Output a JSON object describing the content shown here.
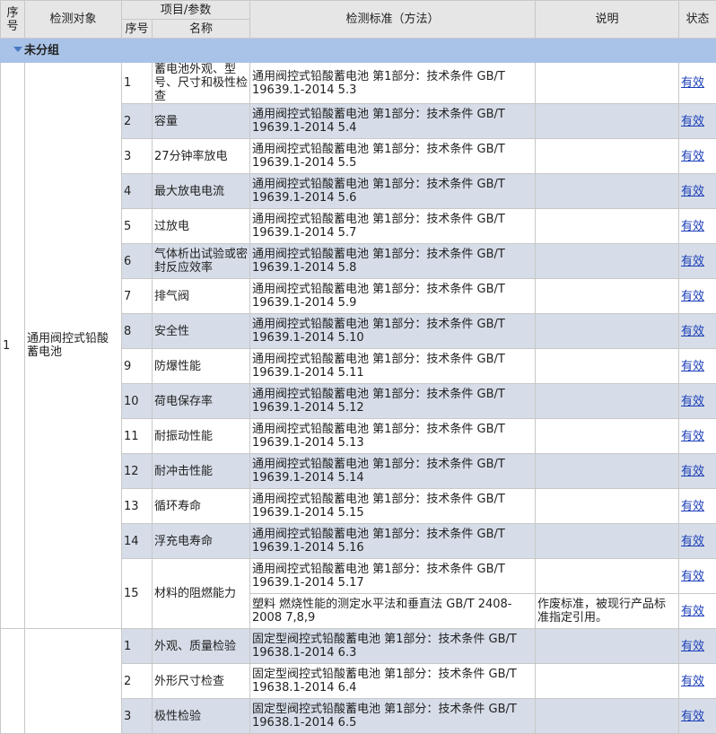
{
  "header": {
    "col_seq": "序号",
    "col_object": "检测对象",
    "col_project": "项目/参数",
    "col_sub_seq": "序号",
    "col_name": "名称",
    "col_standard": "检测标准（方法）",
    "col_note": "说明",
    "col_status": "状态"
  },
  "group": {
    "label": "未分组"
  },
  "objects": [
    {
      "seq": "1",
      "name": "通用阀控式铅酸蓄电池",
      "rows": [
        {
          "no": "1",
          "name": "蓄电池外观、型号、尺寸和极性检查",
          "standard": "通用阀控式铅酸蓄电池 第1部分：技术条件 GB/T 19639.1-2014 5.3",
          "note": "",
          "status": "有效"
        },
        {
          "no": "2",
          "name": "容量",
          "standard": "通用阀控式铅酸蓄电池 第1部分：技术条件 GB/T 19639.1-2014 5.4",
          "note": "",
          "status": "有效"
        },
        {
          "no": "3",
          "name": "27分钟率放电",
          "standard": "通用阀控式铅酸蓄电池 第1部分：技术条件 GB/T 19639.1-2014 5.5",
          "note": "",
          "status": "有效"
        },
        {
          "no": "4",
          "name": "最大放电电流",
          "standard": "通用阀控式铅酸蓄电池 第1部分：技术条件 GB/T 19639.1-2014 5.6",
          "note": "",
          "status": "有效"
        },
        {
          "no": "5",
          "name": "过放电",
          "standard": "通用阀控式铅酸蓄电池 第1部分：技术条件 GB/T 19639.1-2014 5.7",
          "note": "",
          "status": "有效"
        },
        {
          "no": "6",
          "name": "气体析出试验或密封反应效率",
          "standard": "通用阀控式铅酸蓄电池 第1部分：技术条件 GB/T 19639.1-2014 5.8",
          "note": "",
          "status": "有效"
        },
        {
          "no": "7",
          "name": "排气阀",
          "standard": "通用阀控式铅酸蓄电池 第1部分：技术条件 GB/T 19639.1-2014 5.9",
          "note": "",
          "status": "有效"
        },
        {
          "no": "8",
          "name": "安全性",
          "standard": "通用阀控式铅酸蓄电池 第1部分：技术条件 GB/T 19639.1-2014 5.10",
          "note": "",
          "status": "有效"
        },
        {
          "no": "9",
          "name": "防爆性能",
          "standard": "通用阀控式铅酸蓄电池 第1部分：技术条件 GB/T 19639.1-2014 5.11",
          "note": "",
          "status": "有效"
        },
        {
          "no": "10",
          "name": "荷电保存率",
          "standard": "通用阀控式铅酸蓄电池 第1部分：技术条件 GB/T 19639.1-2014 5.12",
          "note": "",
          "status": "有效"
        },
        {
          "no": "11",
          "name": "耐振动性能",
          "standard": "通用阀控式铅酸蓄电池 第1部分：技术条件 GB/T 19639.1-2014 5.13",
          "note": "",
          "status": "有效"
        },
        {
          "no": "12",
          "name": "耐冲击性能",
          "standard": "通用阀控式铅酸蓄电池 第1部分：技术条件 GB/T 19639.1-2014 5.14",
          "note": "",
          "status": "有效"
        },
        {
          "no": "13",
          "name": "循环寿命",
          "standard": "通用阀控式铅酸蓄电池 第1部分：技术条件 GB/T 19639.1-2014 5.15",
          "note": "",
          "status": "有效"
        },
        {
          "no": "14",
          "name": "浮充电寿命",
          "standard": "通用阀控式铅酸蓄电池 第1部分：技术条件 GB/T 19639.1-2014 5.16",
          "note": "",
          "status": "有效"
        },
        {
          "no": "15",
          "name": "材料的阻燃能力",
          "standard": "通用阀控式铅酸蓄电池 第1部分：技术条件 GB/T 19639.1-2014 5.17",
          "note": "",
          "status": "有效",
          "extra": {
            "standard": "塑料 燃烧性能的测定水平法和垂直法 GB/T 2408-2008 7,8,9",
            "note": "作废标准，被现行产品标准指定引用。",
            "status": "有效"
          }
        }
      ]
    },
    {
      "seq": "",
      "name": "",
      "rows": [
        {
          "no": "1",
          "name": "外观、质量检验",
          "standard": "固定型阀控式铅酸蓄电池 第1部分：技术条件 GB/T 19638.1-2014 6.3",
          "note": "",
          "status": "有效"
        },
        {
          "no": "2",
          "name": "外形尺寸检查",
          "standard": "固定型阀控式铅酸蓄电池 第1部分：技术条件 GB/T 19638.1-2014 6.4",
          "note": "",
          "status": "有效"
        },
        {
          "no": "3",
          "name": "极性检验",
          "standard": "固定型阀控式铅酸蓄电池 第1部分：技术条件 GB/T 19638.1-2014 6.5",
          "note": "",
          "status": "有效"
        }
      ]
    }
  ]
}
